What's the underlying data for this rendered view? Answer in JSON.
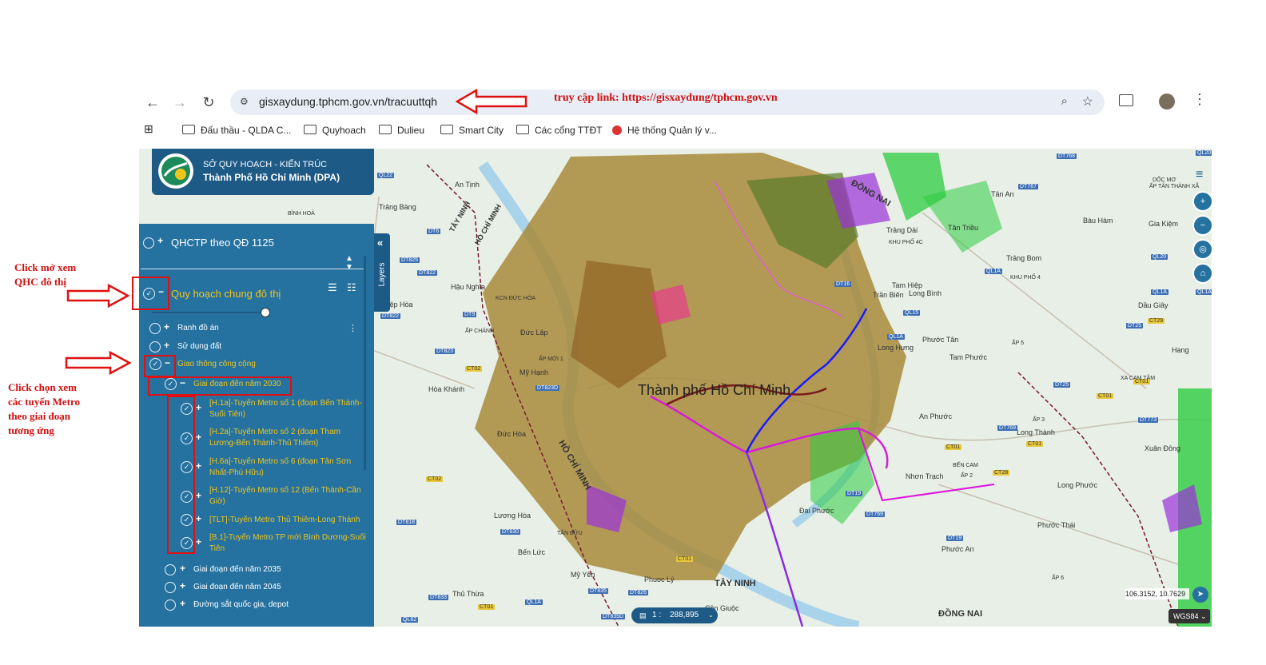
{
  "browser": {
    "url": "gisxaydung.tphcm.gov.vn/tracuuttqh",
    "bookmarks": [
      "Đấu thầu - QLDA C...",
      "Quyhoach",
      "Dulieu",
      "Smart City",
      "Các cổng TTĐT",
      "Hệ thống Quản lý v..."
    ]
  },
  "header": {
    "line1": "SỞ QUY HOẠCH - KIẾN TRÚC",
    "line2": "Thành Phố Hồ Chí Minh (DPA)"
  },
  "panel": {
    "top_layer": "QHCTP theo QĐ 1125",
    "main_group": "Quy hoạch chung đô thị",
    "items": {
      "ranh": "Ranh đồ án",
      "sudung": "Sử dụng đất",
      "giaothong": "Giao thông công cộng",
      "gd2030": "Giai đoạn đến năm 2030",
      "m1a": "[H.1a]-Tuyến Metro số 1 (đoạn Bến Thành-",
      "m1b": "Suối Tiên)",
      "m2a": "[H.2a]-Tuyến Metro số 2 (đoạn Tham",
      "m2b": "Lương-Bến Thành-Thủ Thiêm)",
      "m6a": "[H.6a]-Tuyến Metro số 6 (đoạn Tân Sơn",
      "m6b": "Nhất-Phú Hữu)",
      "m12a": "[H.12]-Tuyến Metro số 12 (Bến Thành-Cần",
      "m12b": "Giờ)",
      "tlt": "[TLT]-Tuyến Metro Thủ Thiêm-Long Thành",
      "b1a": "[B.1]-Tuyến Metro TP mới Bình Dương-Suối",
      "b1b": "Tiên",
      "gd2035": "Giai đoạn đến năm 2035",
      "gd2045": "Giai đoạn đến năm 2045",
      "duongsat": "Đường sắt quốc gia, depot"
    },
    "layers_tab": "Layers"
  },
  "annotations": {
    "top": "truy cập link: https://gisxaydung/tphcm.gov.vn",
    "qhc1": "Click mở xem",
    "qhc2": "QHC đô thị",
    "metro1": "Click chọn xem",
    "metro2": "các tuyến Metro",
    "metro3": "theo giai đoạn",
    "metro4": "tương ứng"
  },
  "map": {
    "scale_prefix": "1 :",
    "scale_value": "288,895",
    "coords": "106.3152, 10.7629",
    "crs": "WGS84",
    "labels": [
      "An Tịnh",
      "Trảng Bàng",
      "BÌNH HOÀ",
      "TÂY NINH",
      "HỒ CHÍ MINH",
      "Hậu Nghĩa",
      "KCN ĐỨC HÒA",
      "Hiệp Hòa",
      "ẤP CHÁNH",
      "Đức Lập",
      "ẤP MỚI 1",
      "Mỹ Hạnh",
      "Hòa Khánh",
      "Đức Hòa",
      "Lương Hòa",
      "TÂN BỬU",
      "Bến Lức",
      "Mỹ Yên",
      "Phuoc Lý",
      "Thủ Thừa",
      "Cần Giuộc",
      "TÂY NINH",
      "HỒ CHÍ MINH",
      "ĐỒNG NAI",
      "Tân An",
      "Tân Triều",
      "Trảng Dài",
      "KHU PHỐ 4C",
      "Trảng Bom",
      "Tam Hiệp",
      "Trần Biên",
      "Long Bình",
      "Long Hưng",
      "Phước Tân",
      "Tam Phước",
      "An Phước",
      "Long Thành",
      "Nhơn Trạch",
      "Đại Phước",
      "Phước Thái",
      "Phước An",
      "Long Phước",
      "Xuân Đông",
      "Bàu Hàm",
      "Gia Kiệm",
      "Dầu Giây",
      "Hang",
      "ẤP 5",
      "ẤP 2",
      "BẾN CAM",
      "ẤP TÂN THÀNH XÃ",
      "DỐC MƠ",
      "ĐỒNG NAI",
      "Thành phố Hồ Chí Minh",
      "ẤP 3",
      "KHU PHỐ 4",
      "ẤP 6",
      "XA CAM TÂM"
    ]
  },
  "colors": {
    "panel": "#2572a0",
    "header": "#1d5a86",
    "accent_yellow": "#f0c419",
    "annotation_red": "#d01010"
  }
}
